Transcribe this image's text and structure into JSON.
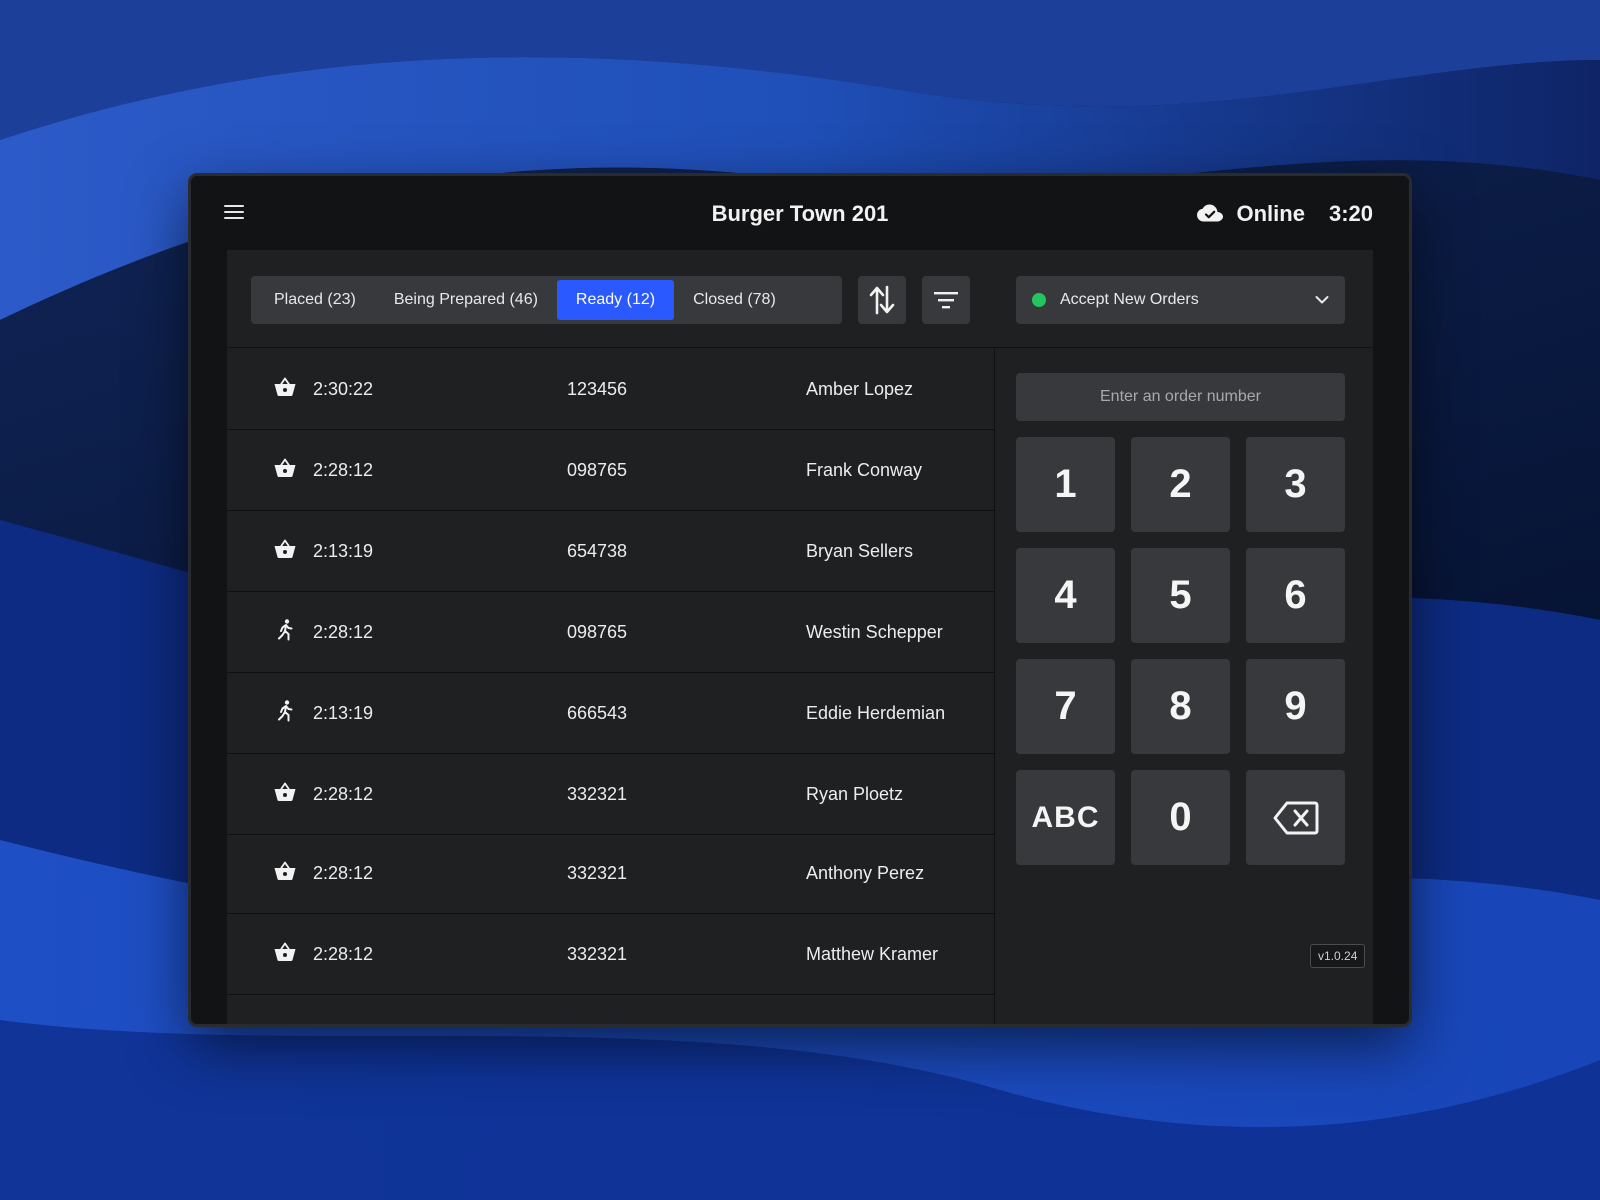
{
  "header": {
    "title": "Burger Town 201",
    "status_label": "Online",
    "time": "3:20"
  },
  "tabs": [
    {
      "label": "Placed (23)",
      "active": false
    },
    {
      "label": "Being Prepared (46)",
      "active": false
    },
    {
      "label": "Ready (12)",
      "active": true
    },
    {
      "label": "Closed (78)",
      "active": false
    }
  ],
  "accept_orders": {
    "label": "Accept New Orders",
    "status_color": "#22c55e"
  },
  "orders": [
    {
      "type_icon": "basket-icon",
      "time": "2:30:22",
      "number": "123456",
      "name": "Amber Lopez"
    },
    {
      "type_icon": "basket-icon",
      "time": "2:28:12",
      "number": "098765",
      "name": "Frank Conway"
    },
    {
      "type_icon": "basket-icon",
      "time": "2:13:19",
      "number": "654738",
      "name": "Bryan Sellers"
    },
    {
      "type_icon": "runner-icon",
      "time": "2:28:12",
      "number": "098765",
      "name": "Westin Schepper"
    },
    {
      "type_icon": "runner-icon",
      "time": "2:13:19",
      "number": "666543",
      "name": "Eddie Herdemian"
    },
    {
      "type_icon": "basket-icon",
      "time": "2:28:12",
      "number": "332321",
      "name": "Ryan Ploetz"
    },
    {
      "type_icon": "basket-icon",
      "time": "2:28:12",
      "number": "332321",
      "name": "Anthony Perez"
    },
    {
      "type_icon": "basket-icon",
      "time": "2:28:12",
      "number": "332321",
      "name": "Matthew Kramer"
    }
  ],
  "search": {
    "placeholder": "Enter an order number"
  },
  "keypad": {
    "keys": [
      "1",
      "2",
      "3",
      "4",
      "5",
      "6",
      "7",
      "8",
      "9",
      "ABC",
      "0"
    ],
    "backspace_icon": "backspace-icon"
  },
  "version": "v1.0.24",
  "colors": {
    "accent": "#2a59ff",
    "online": "#22c55e"
  }
}
